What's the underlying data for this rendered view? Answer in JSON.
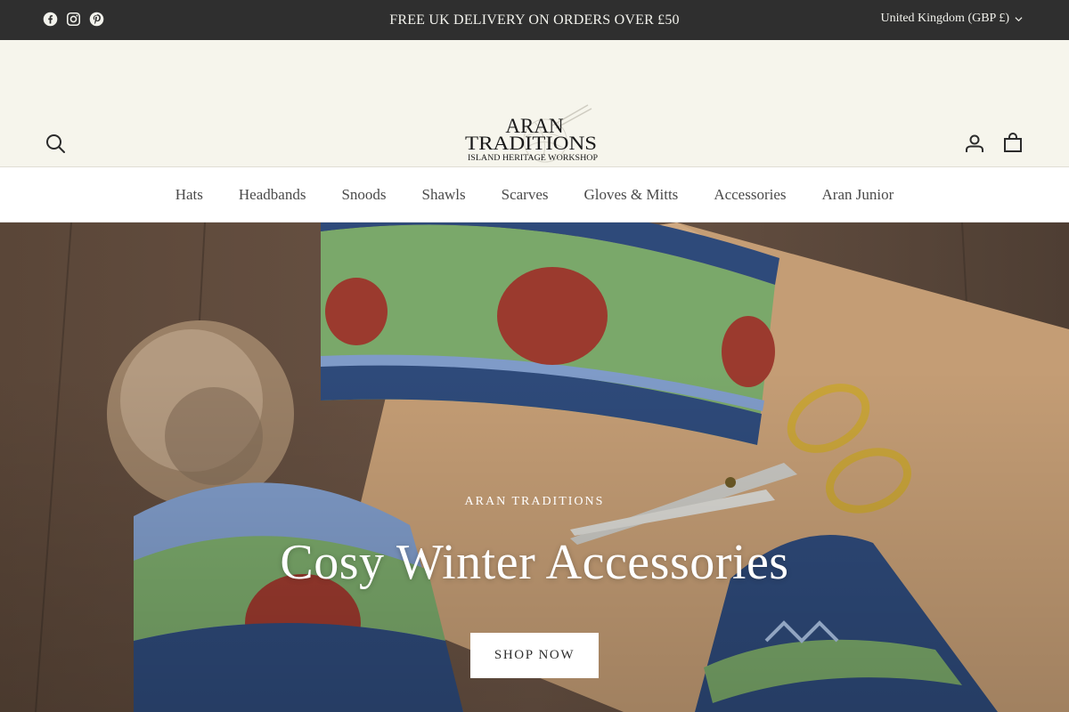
{
  "announcement": {
    "text": "FREE UK DELIVERY ON ORDERS OVER £50",
    "currency": "United Kingdom (GBP £)",
    "social_icons": [
      "facebook-icon",
      "instagram-icon",
      "pinterest-icon"
    ]
  },
  "header": {
    "logo": {
      "line1": "ARAN",
      "line2": "TRADITIONS",
      "tagline": "ISLAND HERITAGE WORKSHOP"
    },
    "icons": [
      "search-icon",
      "account-icon",
      "cart-icon"
    ]
  },
  "nav": {
    "items": [
      "Hats",
      "Headbands",
      "Snoods",
      "Shawls",
      "Scarves",
      "Gloves & Mitts",
      "Accessories",
      "Aran Junior"
    ]
  },
  "hero": {
    "eyebrow": "ARAN TRADITIONS",
    "title": "Cosy Winter Accessories",
    "button": "SHOP NOW"
  },
  "colors": {
    "announcement_bg": "#2f2f2f",
    "header_bg": "#f6f5ec",
    "nav_text": "#4a4a4a"
  }
}
